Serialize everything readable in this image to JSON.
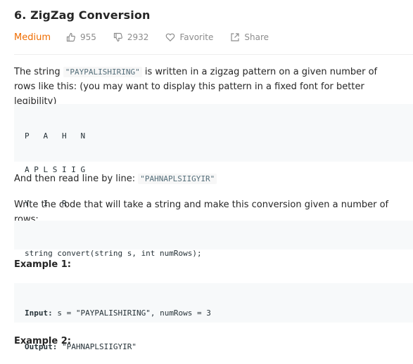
{
  "problem": {
    "title": "6. ZigZag Conversion",
    "difficulty": "Medium",
    "likes": "955",
    "dislikes": "2932",
    "favorite_label": "Favorite",
    "share_label": "Share"
  },
  "description": {
    "intro_before": "The string ",
    "intro_code": "\"PAYPALISHIRING\"",
    "intro_after": " is written in a zigzag pattern on a given number of rows like this: (you may want to display this pattern in a fixed font for better legibility)",
    "pattern_lines": [
      "P   A   H   N",
      "A P L S I I G",
      "Y   I   R"
    ],
    "read_before": "And then read line by line: ",
    "read_code": "\"PAHNAPLSIIGYIR\"",
    "task_text": "Write the code that will take a string and make this conversion given a number of rows:",
    "signature": "string convert(string s, int numRows);"
  },
  "example1": {
    "heading": "Example 1:",
    "input_label": "Input:",
    "input_value": " s = \"PAYPALISHIRING\", numRows = 3",
    "output_label": "Output:",
    "output_value": " \"PAHNAPLSIIGYIR\""
  },
  "example2": {
    "heading": "Example 2:"
  },
  "colors": {
    "difficulty_medium": "#ef6c00",
    "meta_gray": "#8c8c8c",
    "code_block_bg": "#f7f9fa"
  }
}
